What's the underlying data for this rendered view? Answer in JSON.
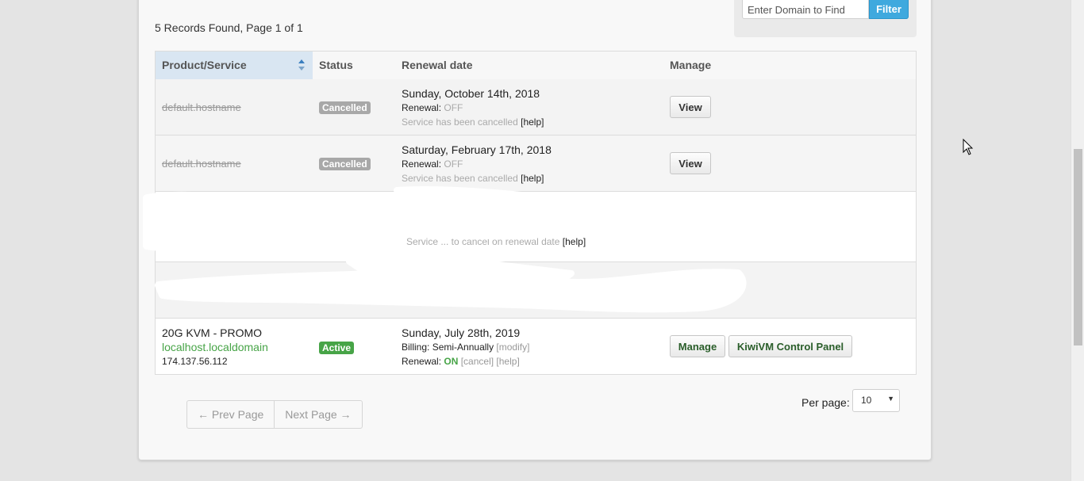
{
  "filter": {
    "placeholder": "Enter Domain to Find",
    "button_label": "Filter"
  },
  "records_summary": "5 Records Found, Page 1 of 1",
  "table": {
    "headers": [
      "Product/Service",
      "Status",
      "Renewal date",
      "Manage"
    ],
    "rows": [
      {
        "hostname": "default.hostname",
        "status": "Cancelled",
        "date": "Sunday, October 14th, 2018",
        "renewal_label": "Renewal:",
        "renewal_value": "OFF",
        "note": "Service has been cancelled",
        "help": "[help]",
        "button": "View"
      },
      {
        "hostname": "default.hostname",
        "status": "Cancelled",
        "date": "Saturday, February 17th, 2018",
        "renewal_label": "Renewal:",
        "renewal_value": "OFF",
        "note": "Service has been cancelled",
        "help": "[help]",
        "button": "View"
      },
      {
        "partial_note": "Service ... to cancel on renewal date",
        "help": "[help]"
      },
      {
        "redacted": true
      },
      {
        "product": "20G KVM - PROMO",
        "hostname": "localhost.localdomain",
        "ip": "174.137.56.112",
        "status": "Active",
        "date": "Sunday, July 28th, 2019",
        "billing_label": "Billing:",
        "billing_value": "Semi-Annually",
        "modify": "[modify]",
        "renewal_label": "Renewal:",
        "renewal_value": "ON",
        "cancel": "[cancel]",
        "help": "[help]",
        "manage_button": "Manage",
        "panel_button": "KiwiVM Control Panel"
      }
    ]
  },
  "pagination": {
    "prev": "← Prev Page",
    "next": "Next Page →"
  },
  "per_page": {
    "label": "Per page:",
    "value": "10"
  },
  "colors": {
    "accent": "#3fa9de",
    "active": "#47a447",
    "cancelled": "#a8a8a8"
  }
}
